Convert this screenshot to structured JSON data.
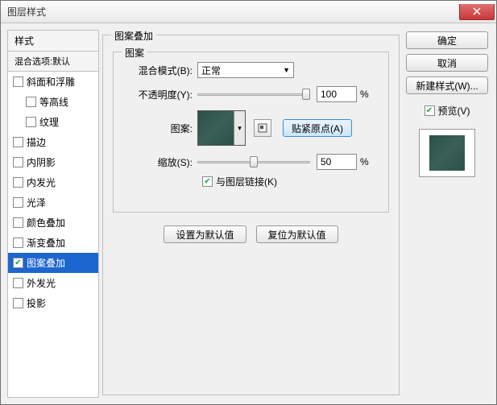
{
  "window": {
    "title": "图层样式"
  },
  "sidebar": {
    "header": "样式",
    "subheader": "混合选项:默认",
    "items": [
      {
        "label": "斜面和浮雕",
        "checked": false,
        "indent": false
      },
      {
        "label": "等高线",
        "checked": false,
        "indent": true
      },
      {
        "label": "纹理",
        "checked": false,
        "indent": true
      },
      {
        "label": "描边",
        "checked": false,
        "indent": false
      },
      {
        "label": "内阴影",
        "checked": false,
        "indent": false
      },
      {
        "label": "内发光",
        "checked": false,
        "indent": false
      },
      {
        "label": "光泽",
        "checked": false,
        "indent": false
      },
      {
        "label": "颜色叠加",
        "checked": false,
        "indent": false
      },
      {
        "label": "渐变叠加",
        "checked": false,
        "indent": false
      },
      {
        "label": "图案叠加",
        "checked": true,
        "indent": false,
        "selected": true
      },
      {
        "label": "外发光",
        "checked": false,
        "indent": false
      },
      {
        "label": "投影",
        "checked": false,
        "indent": false
      }
    ]
  },
  "main": {
    "group_title": "图案叠加",
    "inner_title": "图案",
    "blend_label": "混合模式(B):",
    "blend_value": "正常",
    "opacity_label": "不透明度(Y):",
    "opacity_value": "100",
    "pattern_label": "图案:",
    "snap_label": "贴紧原点(A)",
    "scale_label": "缩放(S):",
    "scale_value": "50",
    "percent": "%",
    "link_label": "与图层链接(K)",
    "link_checked": true,
    "set_default": "设置为默认值",
    "reset_default": "复位为默认值"
  },
  "right": {
    "ok": "确定",
    "cancel": "取消",
    "new_style": "新建样式(W)...",
    "preview_label": "预览(V)",
    "preview_checked": true
  },
  "icons": {
    "swatch_color": "#2d5048"
  }
}
